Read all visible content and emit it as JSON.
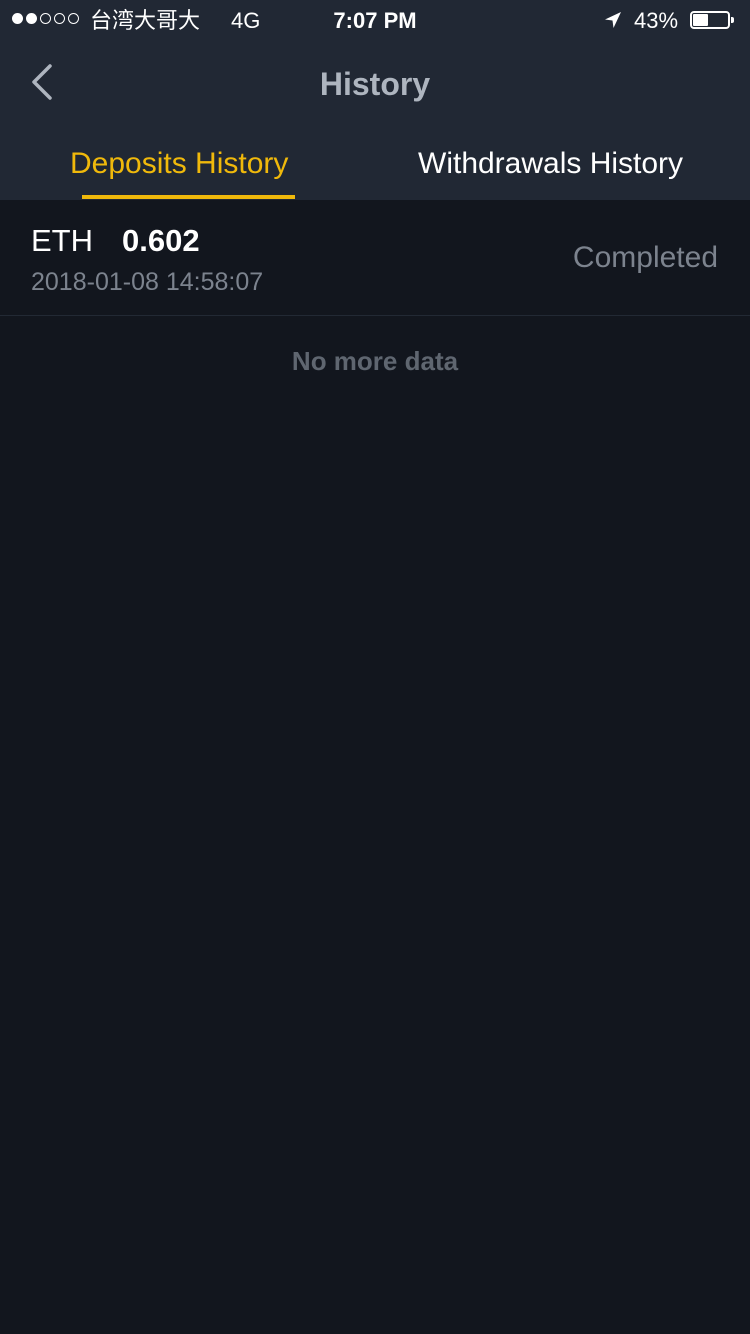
{
  "status_bar": {
    "signal_dots": [
      "full",
      "full",
      "empty",
      "empty",
      "empty"
    ],
    "carrier": "台湾大哥大",
    "network": "4G",
    "time": "7:07 PM",
    "battery_text": "43%",
    "battery_level": 0.43,
    "icons": [
      "signal-icon",
      "location-arrow-icon",
      "battery-icon"
    ]
  },
  "header": {
    "title": "History",
    "back_icon": "chevron-left-icon"
  },
  "tabs": [
    {
      "label": "Deposits History",
      "active": true
    },
    {
      "label": "Withdrawals History",
      "active": false
    }
  ],
  "colors": {
    "accent": "#f0b90b",
    "header_bg": "#212834",
    "page_bg": "#12161e",
    "muted_text": "#7c838e"
  },
  "records": [
    {
      "coin": "ETH",
      "amount": "0.602",
      "timestamp": "2018-01-08 14:58:07",
      "status": "Completed"
    }
  ],
  "list_footer": "No more data"
}
